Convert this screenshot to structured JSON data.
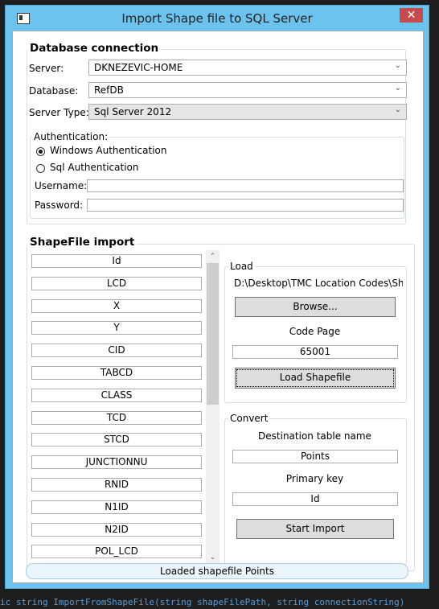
{
  "window": {
    "title": "Import Shape file to SQL Server",
    "close_glyph": "✕"
  },
  "db": {
    "title": "Database connection",
    "server_label": "Server:",
    "server_value": "DKNEZEVIC-HOME",
    "database_label": "Database:",
    "database_value": "RefDB",
    "type_label": "Server Type:",
    "type_value": "Sql Server 2012",
    "auth_title": "Authentication:",
    "auth_windows": "Windows Authentication",
    "auth_sql": "Sql Authentication",
    "username_label": "Username:",
    "username_value": "",
    "password_label": "Password:",
    "password_value": ""
  },
  "shape": {
    "title": "ShapeFile import",
    "fields": [
      "Id",
      "LCD",
      "X",
      "Y",
      "CID",
      "TABCD",
      "CLASS",
      "TCD",
      "STCD",
      "JUNCTIONNU",
      "RNID",
      "N1ID",
      "N2ID",
      "POL_LCD"
    ]
  },
  "load": {
    "title": "Load",
    "path": "D:\\Desktop\\TMC Location Codes\\Shap",
    "browse": "Browse...",
    "codepage_label": "Code Page",
    "codepage_value": "65001",
    "load_button": "Load Shapefile"
  },
  "convert": {
    "title": "Convert",
    "dest_label": "Destination table name",
    "dest_value": "Points",
    "pk_label": "Primary key",
    "pk_value": "Id",
    "start_button": "Start Import"
  },
  "status": "Loaded shapefile Points",
  "background": {
    "bottom_code": "ic string ImportFromShapeFile(string shapeFilePath, string connectionString)"
  },
  "colors": {
    "title_bar": "#6cc3ee",
    "close_button": "#c74b4b",
    "window_bg": "#ffffff"
  }
}
